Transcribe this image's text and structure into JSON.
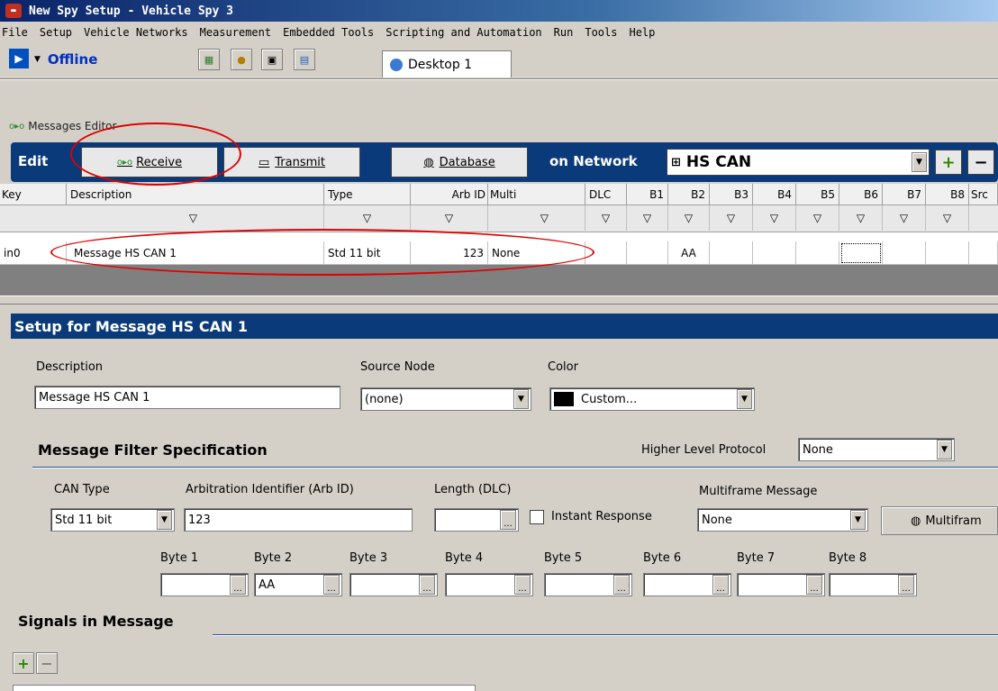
{
  "window": {
    "title": "New Spy Setup - Vehicle Spy 3"
  },
  "menu": [
    "File",
    "Setup",
    "Vehicle Networks",
    "Measurement",
    "Embedded Tools",
    "Scripting and Automation",
    "Run",
    "Tools",
    "Help"
  ],
  "toolbar": {
    "status": "Offline",
    "desktop_tab": "Desktop 1"
  },
  "panel": {
    "caption": "Messages Editor"
  },
  "edit_bar": {
    "edit_label": "Edit",
    "receive_label": "Receive",
    "transmit_label": "Transmit",
    "database_label": "Database",
    "on_network_label": "on Network",
    "network_value": "HS CAN"
  },
  "grid": {
    "columns": [
      "Key",
      "Description",
      "Type",
      "Arb ID",
      "Multi",
      "DLC",
      "B1",
      "B2",
      "B3",
      "B4",
      "B5",
      "B6",
      "B7",
      "B8",
      "Src"
    ],
    "rows": [
      {
        "key": "in0",
        "description": "Message HS CAN 1",
        "type": "Std 11 bit",
        "arb_id": "123",
        "multi": "None",
        "dlc": "",
        "b1": "",
        "b2": "AA",
        "b3": "",
        "b4": "",
        "b5": "",
        "b6": "",
        "b7": "",
        "b8": "",
        "src": ""
      }
    ]
  },
  "setup": {
    "title": "Setup for Message HS CAN 1",
    "description_label": "Description",
    "description_value": "Message HS CAN 1",
    "source_node_label": "Source Node",
    "source_node_value": "(none)",
    "color_label": "Color",
    "color_value": "Custom...",
    "color_swatch": "#000000",
    "filter_section": "Message Filter Specification",
    "hlp_label": "Higher Level Protocol",
    "hlp_value": "None",
    "can_type_label": "CAN Type",
    "can_type_value": "Std 11 bit",
    "arb_id_label": "Arbitration Identifier (Arb ID)",
    "arb_id_value": "123",
    "length_label": "Length (DLC)",
    "length_value": "",
    "instant_response_label": "Instant Response",
    "multiframe_label": "Multiframe Message",
    "multiframe_value": "None",
    "multiframe_button": "Multifram",
    "bytes": [
      {
        "label": "Byte 1",
        "value": ""
      },
      {
        "label": "Byte 2",
        "value": "AA"
      },
      {
        "label": "Byte 3",
        "value": ""
      },
      {
        "label": "Byte 4",
        "value": ""
      },
      {
        "label": "Byte 5",
        "value": ""
      },
      {
        "label": "Byte 6",
        "value": ""
      },
      {
        "label": "Byte 7",
        "value": ""
      },
      {
        "label": "Byte 8",
        "value": ""
      }
    ],
    "signals_section": "Signals in Message"
  },
  "colors": {
    "accent": "#0a3a7a",
    "title_bar": "#0a246a",
    "highlight": "#e00000"
  }
}
